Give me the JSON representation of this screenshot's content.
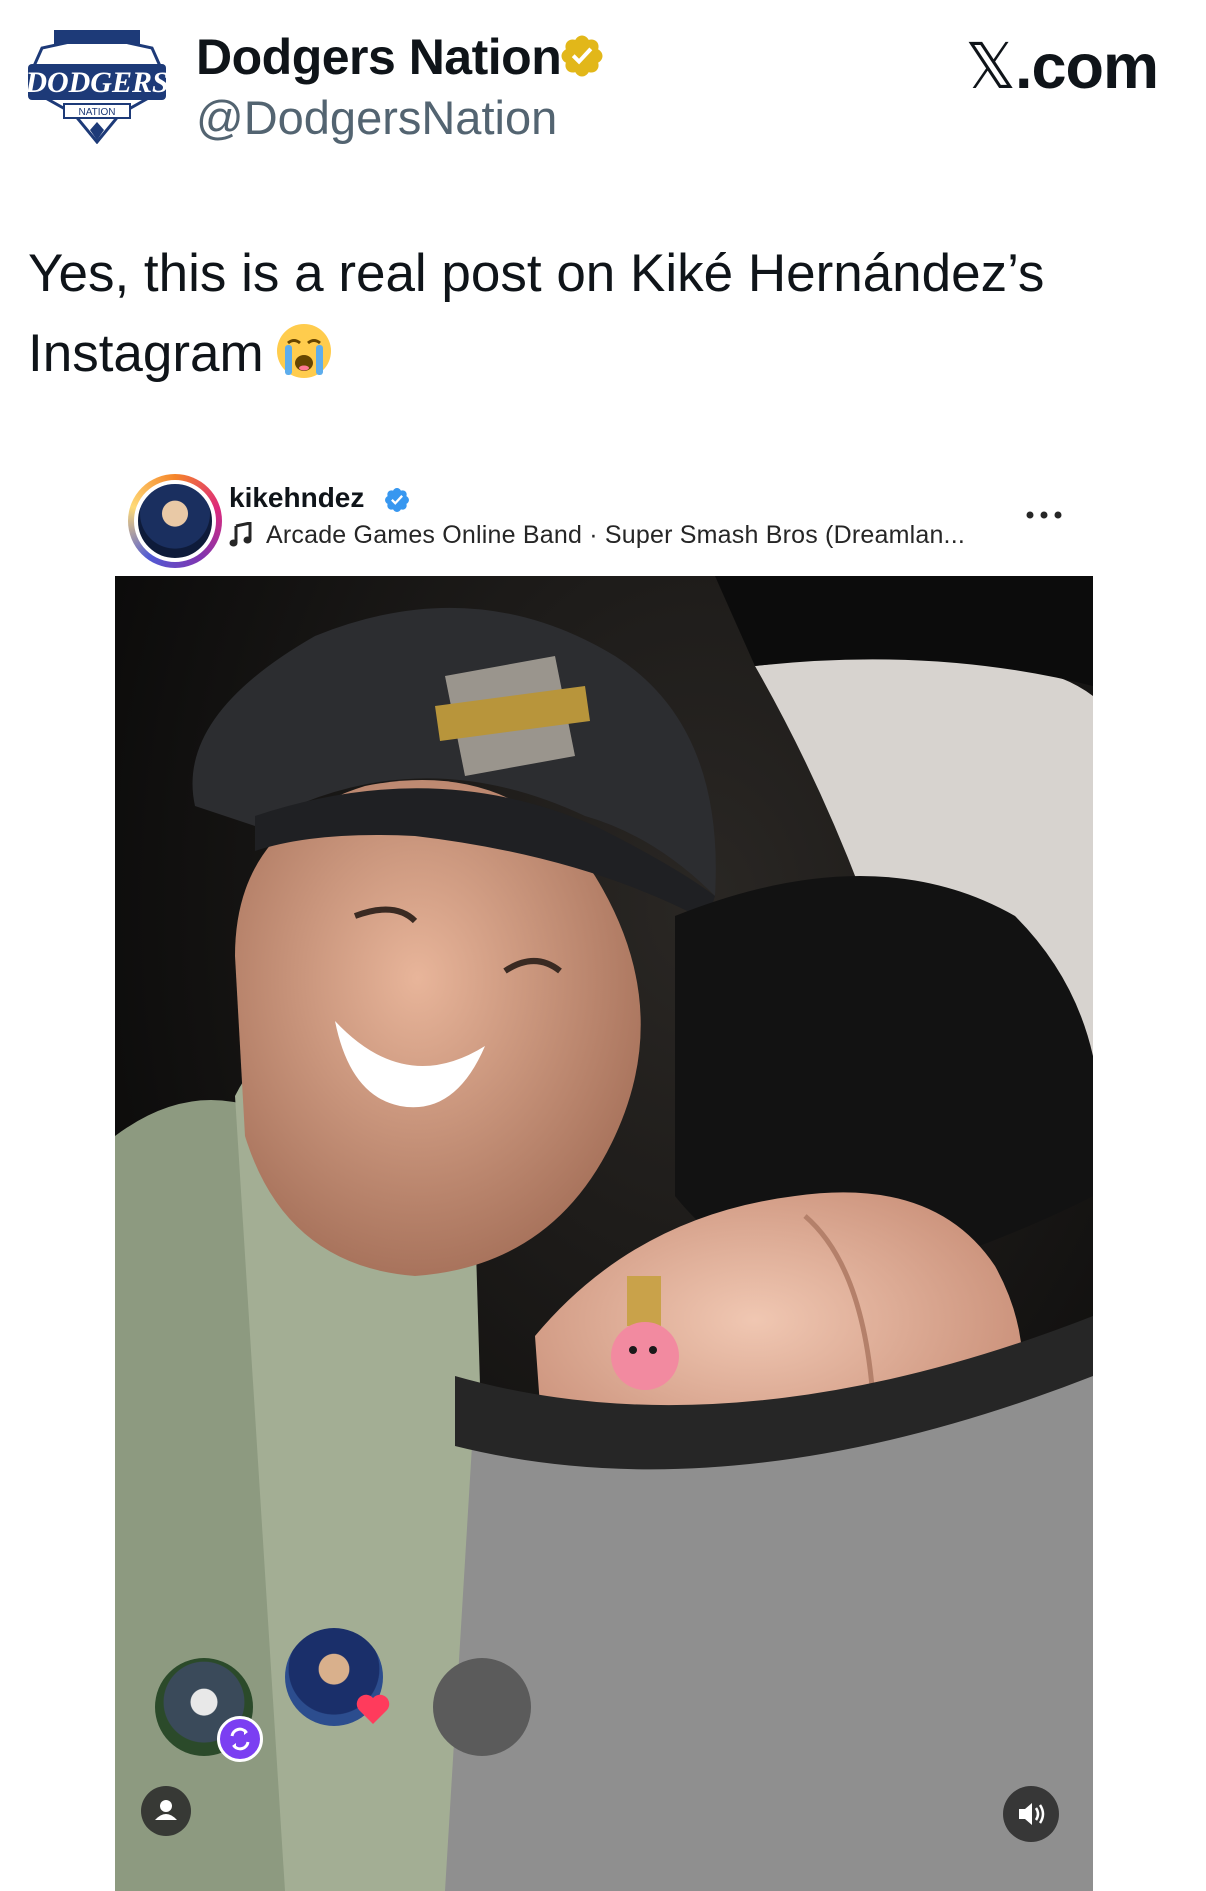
{
  "tweet": {
    "author": {
      "display_name": "Dodgers Nation",
      "handle": "@DodgersNation",
      "verified": "gold",
      "logo_text": "DODGERS",
      "logo_subtext": "NATION"
    },
    "brand": {
      "x_glyph": "𝕏",
      "suffix": ".com"
    },
    "text": "Yes, this is a real post on Kiké Hernández’s Instagram",
    "emoji": "loudly-crying-face"
  },
  "instagram_post": {
    "username": "kikehndez",
    "verified": "blue",
    "music": "Arcade Games Online Band · Super Smash Bros (Dreamlan...",
    "icons": {
      "music": "music-note-icon",
      "more": "more-options-icon",
      "profile": "person-icon",
      "sound": "speaker-icon",
      "repost": "repost-icon",
      "like": "heart-icon"
    }
  },
  "colors": {
    "text": "#0f1419",
    "secondary_text": "#536471",
    "gold_badge": "#e2b719",
    "blue_badge": "#3797f0",
    "repost_purple": "#7b3ff2"
  }
}
